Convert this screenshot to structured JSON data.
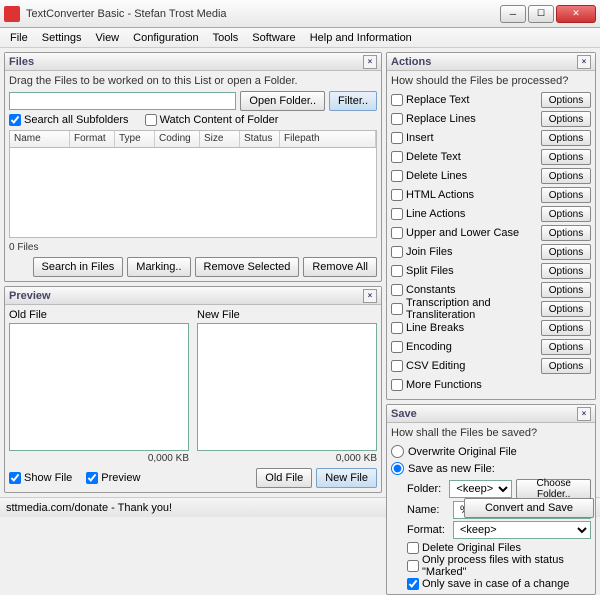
{
  "window": {
    "title": "TextConverter Basic - Stefan Trost Media"
  },
  "menu": [
    "File",
    "Settings",
    "View",
    "Configuration",
    "Tools",
    "Software",
    "Help and Information"
  ],
  "files": {
    "title": "Files",
    "hint": "Drag the Files to be worked on to this List or open a Folder.",
    "open": "Open Folder..",
    "filter": "Filter..",
    "search_sub": "Search all Subfolders",
    "watch": "Watch Content of Folder",
    "cols": [
      "Name",
      "Format",
      "Type",
      "Coding",
      "Size",
      "Status",
      "Filepath"
    ],
    "count": "0 Files",
    "search_in": "Search in Files",
    "marking": "Marking..",
    "remove_sel": "Remove Selected",
    "remove_all": "Remove All"
  },
  "preview": {
    "title": "Preview",
    "old": "Old File",
    "new": "New File",
    "size": "0,000 KB",
    "show_file": "Show File",
    "preview_chk": "Preview",
    "old_btn": "Old File",
    "new_btn": "New File"
  },
  "actions": {
    "title": "Actions",
    "hint": "How should the Files be processed?",
    "items": [
      "Replace Text",
      "Replace Lines",
      "Insert",
      "Delete Text",
      "Delete Lines",
      "HTML Actions",
      "Line Actions",
      "Upper and Lower Case",
      "Join Files",
      "Split Files",
      "Constants",
      "Transcription and Transliteration",
      "Line Breaks",
      "Encoding",
      "CSV Editing",
      "More Functions"
    ],
    "options": "Options"
  },
  "save": {
    "title": "Save",
    "hint": "How shall the Files be saved?",
    "overwrite": "Overwrite Original File",
    "saveas": "Save as new File:",
    "folder_lbl": "Folder:",
    "folder_val": "<keep>",
    "choose": "Choose Folder..",
    "name_lbl": "Name:",
    "name_val": "%name%-1",
    "format_lbl": "Format:",
    "format_val": "<keep>",
    "del_orig": "Delete Original Files",
    "only_marked": "Only process files with status \"Marked\"",
    "only_change": "Only save in case of a change"
  },
  "status": {
    "text": "sttmedia.com/donate - Thank you!",
    "convert": "Convert and Save"
  }
}
